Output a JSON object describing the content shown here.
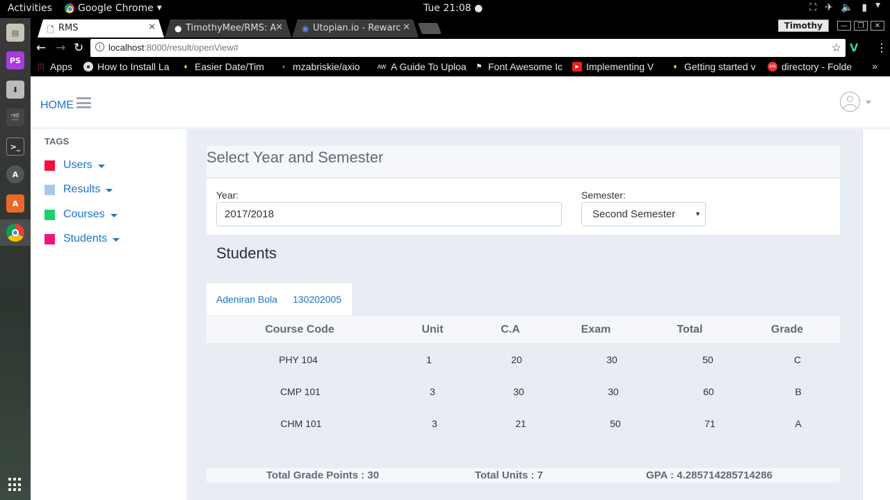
{
  "system": {
    "activities": "Activities",
    "app_name": "Google Chrome",
    "clock": "Tue 21:08"
  },
  "browser": {
    "tabs": [
      {
        "title": "RMS"
      },
      {
        "title": "TimothyMee/RMS: A"
      },
      {
        "title": "Utopian.io - Rewarc"
      }
    ],
    "profile_name": "Timothy",
    "url_host": "localhost",
    "url_path": ":8000/result/openView#",
    "bookmarks": [
      {
        "label": "Apps"
      },
      {
        "label": "How to Install La"
      },
      {
        "label": "Easier Date/Tim"
      },
      {
        "label": "mzabriskie/axio"
      },
      {
        "label": "A Guide To Uploa"
      },
      {
        "label": "Font Awesome Ic"
      },
      {
        "label": "Implementing V"
      },
      {
        "label": "Getting started v"
      },
      {
        "label": "directory - Folde"
      }
    ]
  },
  "navbar": {
    "home_label": "HOME"
  },
  "sidebar": {
    "heading": "TAGS",
    "items": [
      {
        "label": "Users",
        "color": "#f0123c"
      },
      {
        "label": "Results",
        "color": "#a9c7e6"
      },
      {
        "label": "Courses",
        "color": "#18d468"
      },
      {
        "label": "Students",
        "color": "#f7127f"
      }
    ]
  },
  "filter": {
    "title": "Select Year and Semester",
    "year_label": "Year:",
    "year_value": "2017/2018",
    "semester_label": "Semester:",
    "semester_value": "Second Semester"
  },
  "students": {
    "title": "Students",
    "selected": {
      "name": "Adeniran Bola",
      "matric": "130202005"
    }
  },
  "results_table": {
    "headers": [
      "Course Code",
      "Unit",
      "C.A",
      "Exam",
      "Total",
      "Grade"
    ],
    "rows": [
      [
        "PHY 104",
        "1",
        "20",
        "30",
        "50",
        "C"
      ],
      [
        "CMP 101",
        "3",
        "30",
        "30",
        "60",
        "B"
      ],
      [
        "CHM 101",
        "3",
        "21",
        "50",
        "71",
        "A"
      ]
    ]
  },
  "summary": {
    "total_grade_points": "Total Grade Points : 30",
    "total_units": "Total Units : 7",
    "gpa": "GPA : 4.285714285714286"
  },
  "colors": {
    "link": "#1a73c8",
    "content_bg": "#e8ecf3"
  }
}
